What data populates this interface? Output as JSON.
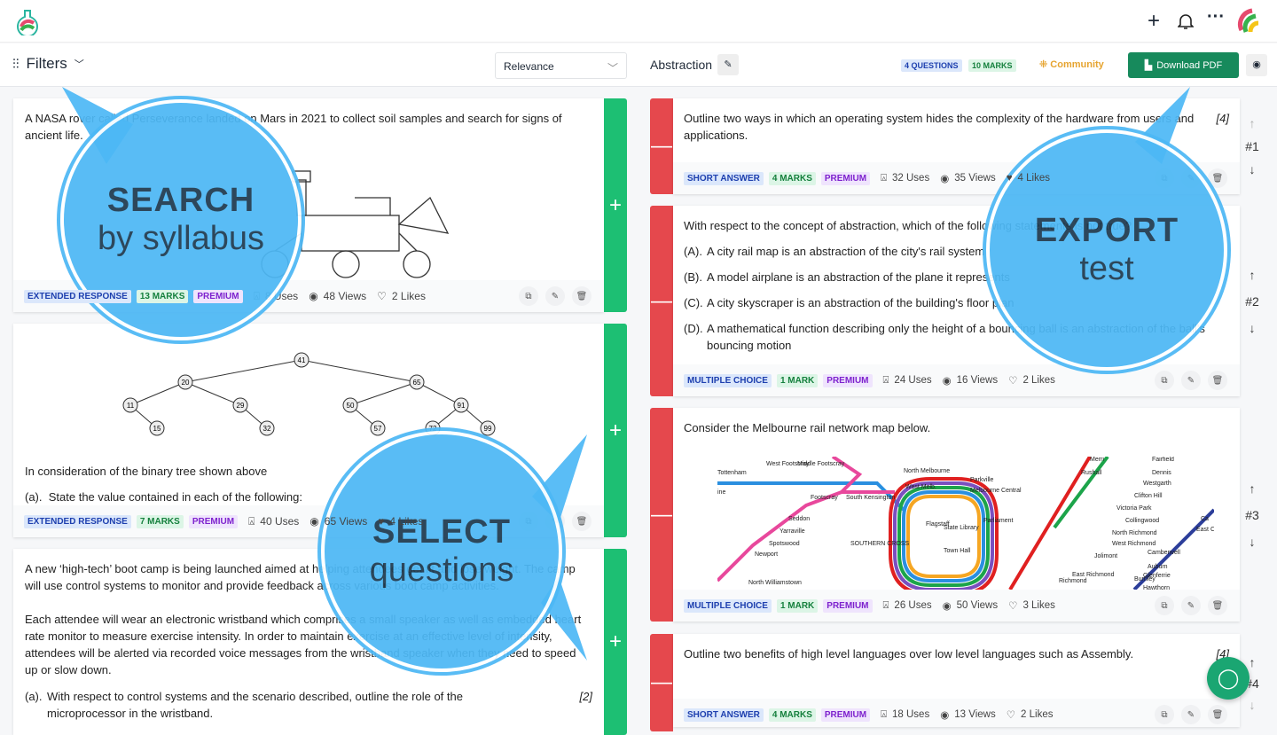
{
  "header": {
    "logo": "flask-logo",
    "icons": [
      "plus-icon",
      "bell-icon",
      "more-icon",
      "avatar"
    ]
  },
  "toolbar": {
    "filters": "Filters",
    "sort": "Relevance",
    "test_title": "Abstraction",
    "questions_badge": "4 QUESTIONS",
    "marks_badge": "10 MARKS",
    "community": "Community",
    "download": "Download PDF"
  },
  "bank": [
    {
      "text": "A NASA rover called Perseverance landed on Mars in 2021 to collect soil samples and search for signs of ancient life.",
      "type": "EXTENDED RESPONSE",
      "marks": "13 MARKS",
      "tier": "PREMIUM",
      "uses": "8 Uses",
      "views": "48 Views",
      "likes": "2 Likes"
    },
    {
      "tree": [
        "41",
        "20",
        "65",
        "11",
        "29",
        "50",
        "91",
        "15",
        "32",
        "57",
        "72",
        "99"
      ],
      "text": "In consideration of the binary tree shown above",
      "part_label": "(a).",
      "part": "State the value contained in each of the following:",
      "type": "EXTENDED RESPONSE",
      "marks": "7 MARKS",
      "tier": "PREMIUM",
      "uses": "40 Uses",
      "views": "65 Views",
      "likes": "4 Likes"
    },
    {
      "text": "A new ‘high-tech’ boot camp is being launched aimed at helping attendees get fit and lose weight. The camp will use control systems to monitor and provide feedback across various boot camp activities.",
      "text2": "Each attendee will wear an electronic wristband which comprises a small speaker as well as embedded heart rate monitor to measure exercise intensity. In order to maintain exercise at an effective level of intensity, attendees will be alerted via recorded voice messages from the wristband speaker when they need to speed up or slow down.",
      "part_label": "(a).",
      "part": "With respect to control systems and the scenario described, outline the role of the microprocessor in the wristband.",
      "part_marks": "[2]"
    }
  ],
  "test": [
    {
      "text": "Outline two ways in which an operating system hides the complexity of the hardware from users and applications.",
      "marks_note": "[4]",
      "num": "#1",
      "type": "SHORT ANSWER",
      "marks": "4 MARKS",
      "tier": "PREMIUM",
      "uses": "32 Uses",
      "views": "35 Views",
      "likes": "4 Likes"
    },
    {
      "text": "With respect to the concept of abstraction, which of the following statements is not true?",
      "options": [
        {
          "l": "(A).",
          "t": "A city rail map is an abstraction of the city's rail system"
        },
        {
          "l": "(B).",
          "t": "A model airplane is an abstraction of the plane it represents"
        },
        {
          "l": "(C).",
          "t": "A city skyscraper is an abstraction of the building's floor plan"
        },
        {
          "l": "(D).",
          "t": "A mathematical function describing only the height of a bouncing ball is an abstraction of the ball's bouncing motion"
        }
      ],
      "num": "#2",
      "type": "MULTIPLE CHOICE",
      "marks": "1 MARK",
      "tier": "PREMIUM",
      "uses": "24 Uses",
      "views": "16 Views",
      "likes": "2 Likes"
    },
    {
      "text": "Consider the Melbourne rail network map below.",
      "map_labels": [
        "Tottenham",
        "West Footscray",
        "Middle Footscray",
        "North Melbourne",
        "Parkville",
        "West Melb.",
        "Melbourne Central",
        "Footscray",
        "South Kensington",
        "Seddon",
        "Yarraville",
        "Spotswood",
        "Newport",
        "North Williamstown",
        "Flagstaff",
        "State Library",
        "Town Hall",
        "Parliament",
        "SOUTHERN CROSS",
        "Merri",
        "Rushall",
        "Fairfield",
        "Dennis",
        "Westgarth",
        "Clifton Hill",
        "Victoria Park",
        "Collingwood",
        "North Richmond",
        "West Richmond",
        "Jolimont",
        "East Richmond",
        "Richmond",
        "Burnley",
        "Camberwell",
        "Auburn",
        "Glenferrie",
        "Hawthorn",
        "East Ca",
        "Ca",
        "ine"
      ],
      "num": "#3",
      "type": "MULTIPLE CHOICE",
      "marks": "1 MARK",
      "tier": "PREMIUM",
      "uses": "26 Uses",
      "views": "50 Views",
      "likes": "3 Likes"
    },
    {
      "text": "Outline two benefits of high level languages over low level languages such as Assembly.",
      "marks_note": "[4]",
      "num": "#4",
      "type": "SHORT ANSWER",
      "marks": "4 MARKS",
      "tier": "PREMIUM",
      "uses": "18 Uses",
      "views": "13 Views",
      "likes": "2 Likes"
    }
  ],
  "callouts": {
    "search_big": "SEARCH",
    "search_small": "by syllabus",
    "select_big": "SELECT",
    "select_small": "questions",
    "export_big": "EXPORT",
    "export_small": "test"
  },
  "colors": {
    "add": "#1dbf73",
    "remove": "#e5484d",
    "primary": "#178a5c",
    "callout": "#4db8f5"
  }
}
